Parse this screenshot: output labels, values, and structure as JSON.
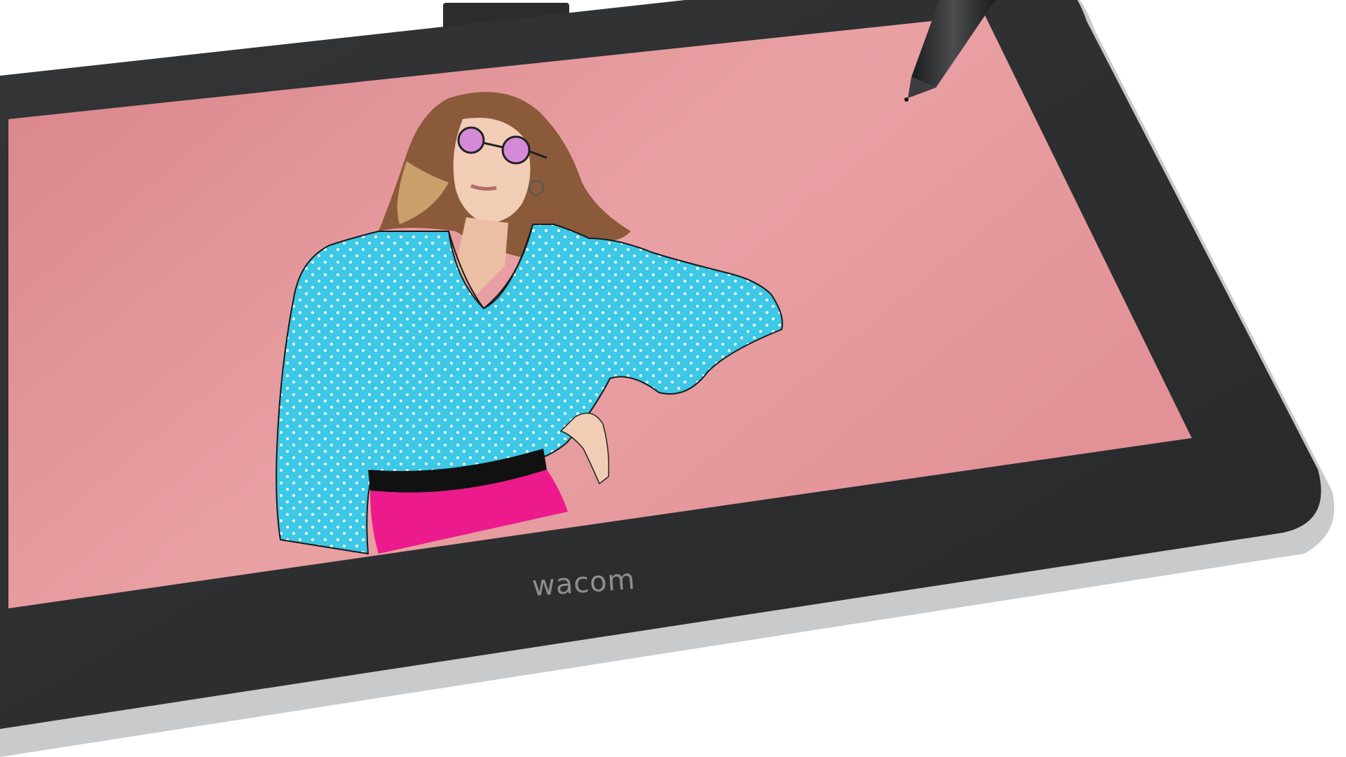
{
  "device": {
    "brand": "wacom",
    "brand_color": "#8e8e8e",
    "bezel_color": "#2b2d2e",
    "body_color": "#c9cacc"
  },
  "screen": {
    "background_color": "#e5989c",
    "illustration": {
      "shirt_color": "#3cc8e6",
      "pants_color": "#ec1a8c",
      "belt_color": "#111111",
      "hair_color": "#8a5a3a",
      "lens_color": "#d48ad6"
    }
  },
  "pen": {
    "color": "#2a2c2e"
  }
}
